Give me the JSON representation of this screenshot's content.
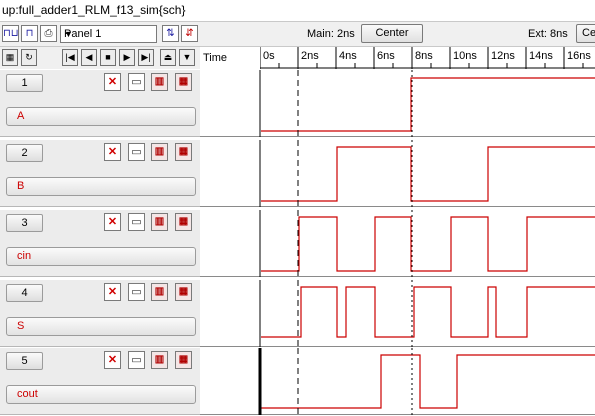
{
  "title": "up:full_adder1_RLM_f13_sim{sch}",
  "toolbar": {
    "panel_select": "Panel 1",
    "main_label": "Main: 2ns",
    "center_label": "Center",
    "ext_label": "Ext: 8ns",
    "ext_button_label": "Ce"
  },
  "nav": {
    "time_label": "Time"
  },
  "ruler": {
    "ticks": [
      "0s",
      "2ns",
      "4ns",
      "6ns",
      "8ns",
      "10ns",
      "12ns",
      "14ns",
      "16ns"
    ]
  },
  "signals": [
    {
      "index": "1",
      "name": "A"
    },
    {
      "index": "2",
      "name": "B"
    },
    {
      "index": "3",
      "name": "cin"
    },
    {
      "index": "4",
      "name": "S"
    },
    {
      "index": "5",
      "name": "cout"
    }
  ],
  "cursors": {
    "main_ns": 2,
    "ext_ns": 8
  },
  "colors": {
    "waveform": "#cc0000",
    "cursor": "#000000"
  }
}
